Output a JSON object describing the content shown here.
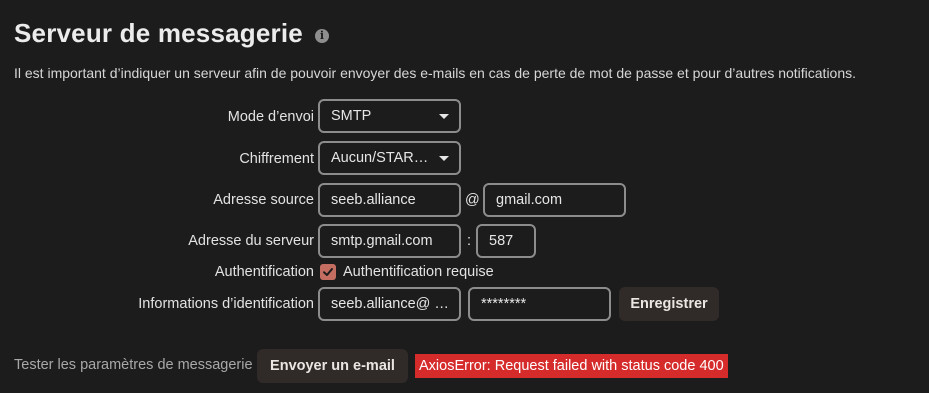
{
  "header": {
    "title": "Serveur de messagerie",
    "info_icon": "info-icon",
    "description": "Il est important d’indiquer un serveur afin de pouvoir envoyer des e-mails en cas de perte de mot de passe et pour d’autres notifications."
  },
  "form": {
    "send_mode": {
      "label": "Mode d’envoi",
      "value": "SMTP"
    },
    "encryption": {
      "label": "Chiffrement",
      "value": "Aucun/STAR…"
    },
    "from_address": {
      "label": "Adresse source",
      "local_part": "seeb.alliance",
      "separator": "@",
      "domain": "gmail.com"
    },
    "server_address": {
      "label": "Adresse du serveur",
      "host": "smtp.gmail.com",
      "separator": ":",
      "port": "587"
    },
    "authentication": {
      "label": "Authentification",
      "checkbox_label": "Authentification requise",
      "checked": true
    },
    "credentials": {
      "label": "Informations d’identification",
      "username": "seeb.alliance@ …",
      "password": "********",
      "save_button": "Enregistrer"
    }
  },
  "test": {
    "label": "Tester les paramètres de messagerie",
    "send_button": "Envoyer un e-mail",
    "error": "AxiosError: Request failed with status code 400"
  },
  "colors": {
    "background": "#1c1c1c",
    "checkbox": "#c46e61",
    "error": "#d52b2b",
    "button": "#302a28"
  }
}
